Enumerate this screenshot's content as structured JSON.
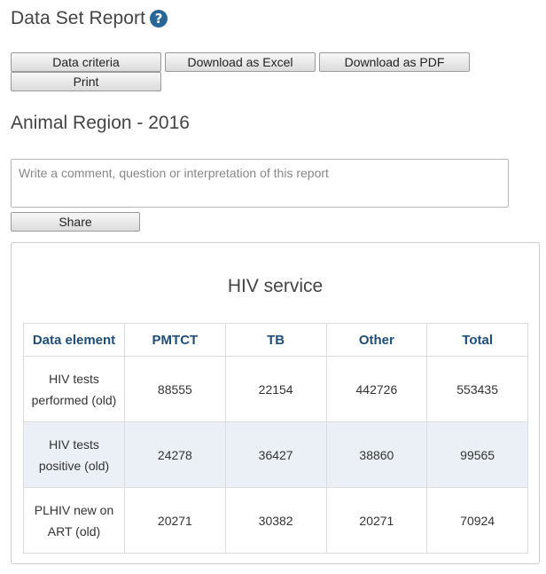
{
  "header": {
    "title": "Data Set Report",
    "help_glyph": "?"
  },
  "toolbar": {
    "criteria_label": "Data criteria",
    "excel_label": "Download as Excel",
    "pdf_label": "Download as PDF",
    "print_label": "Print"
  },
  "report": {
    "title": "Animal Region - 2016",
    "comment_placeholder": "Write a comment, question or interpretation of this report",
    "share_label": "Share"
  },
  "table": {
    "title": "HIV service",
    "headers": [
      "Data element",
      "PMTCT",
      "TB",
      "Other",
      "Total"
    ],
    "rows": [
      {
        "label": "HIV tests performed (old)",
        "values": [
          "88555",
          "22154",
          "442726",
          "553435"
        ]
      },
      {
        "label": "HIV tests positive (old)",
        "values": [
          "24278",
          "36427",
          "38860",
          "99565"
        ]
      },
      {
        "label": "PLHIV new on ART (old)",
        "values": [
          "20271",
          "30382",
          "20271",
          "70924"
        ]
      }
    ]
  },
  "colors": {
    "header_text": "#1f4e79",
    "help_icon": "#276696",
    "alt_row": "#eaf0f6"
  },
  "icons": {
    "help": "help-icon"
  }
}
